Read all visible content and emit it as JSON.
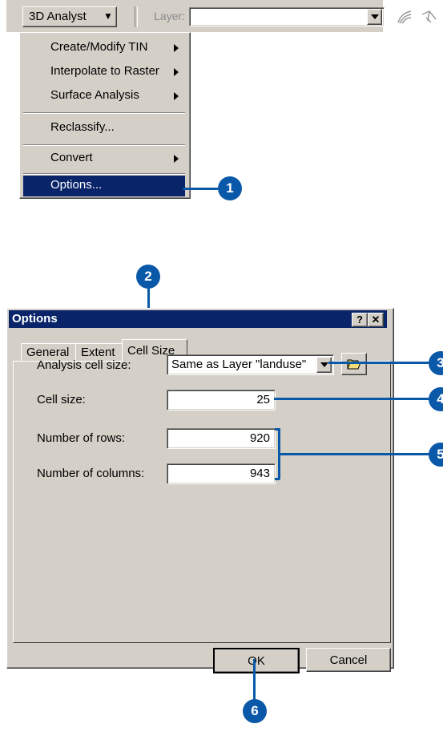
{
  "toolbar": {
    "menu_button_label": "3D Analyst",
    "layer_label": "Layer:",
    "layer_value": ""
  },
  "menu": {
    "items": [
      {
        "label": "Create/Modify TIN",
        "submenu": true
      },
      {
        "label": "Interpolate to Raster",
        "submenu": true
      },
      {
        "label": "Surface Analysis",
        "submenu": true
      },
      {
        "label": "Reclassify...",
        "submenu": false
      },
      {
        "label": "Convert",
        "submenu": true
      },
      {
        "label": "Options...",
        "submenu": false,
        "selected": true
      }
    ]
  },
  "dialog": {
    "title": "Options",
    "help_label": "?",
    "close_label": "✕",
    "tabs": [
      "General",
      "Extent",
      "Cell Size"
    ],
    "active_tab": "Cell Size",
    "fields": {
      "analysis_cell_size_label": "Analysis cell size:",
      "analysis_cell_size_value": "Same as Layer \"landuse\"",
      "cell_size_label": "Cell size:",
      "cell_size_value": "25",
      "rows_label": "Number of rows:",
      "rows_value": "920",
      "columns_label": "Number of columns:",
      "columns_value": "943"
    },
    "ok_label": "OK",
    "cancel_label": "Cancel"
  },
  "callouts": [
    "1",
    "2",
    "3",
    "4",
    "5",
    "6"
  ],
  "colors": {
    "accent": "#0a58a8",
    "selection": "#0a246a",
    "face": "#d4d0c8"
  }
}
